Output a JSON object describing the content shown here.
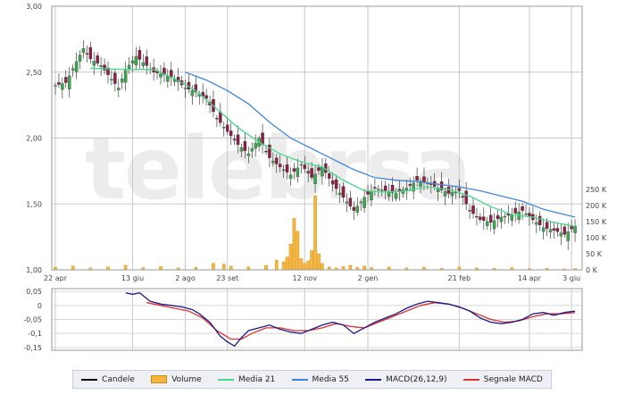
{
  "watermark": "telebrsa",
  "colors": {
    "bull": "#3ea64e",
    "bear": "#8e1f44",
    "volume": "#f5b63c",
    "volume_edge": "#d08a10",
    "ma21": "#45d98a",
    "ma55": "#3f86d8",
    "macd": "#1a1a8c",
    "signal": "#e03030",
    "grid": "#c8c8c8"
  },
  "legend": [
    {
      "label": "Candele",
      "type": "line",
      "color": "#000000"
    },
    {
      "label": "Volume",
      "type": "bar",
      "color": "#f5b63c"
    },
    {
      "label": "Media 21",
      "type": "line",
      "color": "#45d98a"
    },
    {
      "label": "Media 55",
      "type": "line",
      "color": "#3f86d8"
    },
    {
      "label": "MACD(26,12,9)",
      "type": "line",
      "color": "#1a1a8c"
    },
    {
      "label": "Segnale MACD",
      "type": "line",
      "color": "#e03030"
    }
  ],
  "chart_data": [
    {
      "type": "candlestick",
      "title": "",
      "x_tick_labels": [
        "22 apr",
        "13 giu",
        "2 ago",
        "23 set",
        "12 nov",
        "2 gen",
        "21 feb",
        "14 apr",
        "3 giu"
      ],
      "ylim": [
        1.0,
        3.0
      ],
      "y_tick_labels": [
        "3,00",
        "2,50",
        "2,00",
        "1,50",
        "1,00"
      ],
      "volume_ylim": [
        0,
        250000
      ],
      "volume_tick_labels": [
        "250 K",
        "200 K",
        "150 K",
        "100 K",
        "50 K",
        "0 K"
      ],
      "grid": true,
      "close_series": [
        {
          "x": 0,
          "y": 2.4
        },
        {
          "x": 3,
          "y": 2.42
        },
        {
          "x": 6,
          "y": 2.58
        },
        {
          "x": 8,
          "y": 2.68
        },
        {
          "x": 10,
          "y": 2.6
        },
        {
          "x": 13,
          "y": 2.55
        },
        {
          "x": 15,
          "y": 2.48
        },
        {
          "x": 18,
          "y": 2.38
        },
        {
          "x": 20,
          "y": 2.52
        },
        {
          "x": 23,
          "y": 2.62
        },
        {
          "x": 26,
          "y": 2.55
        },
        {
          "x": 28,
          "y": 2.5
        },
        {
          "x": 31,
          "y": 2.48
        },
        {
          "x": 34,
          "y": 2.45
        },
        {
          "x": 37,
          "y": 2.38
        },
        {
          "x": 40,
          "y": 2.35
        },
        {
          "x": 43,
          "y": 2.3
        },
        {
          "x": 46,
          "y": 2.15
        },
        {
          "x": 49,
          "y": 2.05
        },
        {
          "x": 52,
          "y": 1.95
        },
        {
          "x": 55,
          "y": 1.88
        },
        {
          "x": 58,
          "y": 2.0
        },
        {
          "x": 61,
          "y": 1.85
        },
        {
          "x": 64,
          "y": 1.78
        },
        {
          "x": 67,
          "y": 1.72
        },
        {
          "x": 70,
          "y": 1.8
        },
        {
          "x": 73,
          "y": 1.7
        },
        {
          "x": 76,
          "y": 1.78
        },
        {
          "x": 79,
          "y": 1.65
        },
        {
          "x": 82,
          "y": 1.55
        },
        {
          "x": 85,
          "y": 1.45
        },
        {
          "x": 88,
          "y": 1.55
        },
        {
          "x": 91,
          "y": 1.62
        },
        {
          "x": 94,
          "y": 1.6
        },
        {
          "x": 97,
          "y": 1.58
        },
        {
          "x": 100,
          "y": 1.62
        },
        {
          "x": 103,
          "y": 1.68
        },
        {
          "x": 106,
          "y": 1.66
        },
        {
          "x": 109,
          "y": 1.62
        },
        {
          "x": 112,
          "y": 1.58
        },
        {
          "x": 115,
          "y": 1.6
        },
        {
          "x": 118,
          "y": 1.45
        },
        {
          "x": 121,
          "y": 1.38
        },
        {
          "x": 124,
          "y": 1.36
        },
        {
          "x": 127,
          "y": 1.4
        },
        {
          "x": 130,
          "y": 1.42
        },
        {
          "x": 133,
          "y": 1.45
        },
        {
          "x": 136,
          "y": 1.38
        },
        {
          "x": 139,
          "y": 1.32
        },
        {
          "x": 142,
          "y": 1.3
        },
        {
          "x": 145,
          "y": 1.27
        },
        {
          "x": 148,
          "y": 1.33
        }
      ],
      "media21": [
        {
          "x": 10,
          "y": 2.53
        },
        {
          "x": 20,
          "y": 2.52
        },
        {
          "x": 28,
          "y": 2.52
        },
        {
          "x": 34,
          "y": 2.45
        },
        {
          "x": 40,
          "y": 2.36
        },
        {
          "x": 46,
          "y": 2.22
        },
        {
          "x": 52,
          "y": 2.08
        },
        {
          "x": 58,
          "y": 1.97
        },
        {
          "x": 64,
          "y": 1.88
        },
        {
          "x": 70,
          "y": 1.82
        },
        {
          "x": 76,
          "y": 1.78
        },
        {
          "x": 82,
          "y": 1.68
        },
        {
          "x": 88,
          "y": 1.6
        },
        {
          "x": 94,
          "y": 1.59
        },
        {
          "x": 100,
          "y": 1.6
        },
        {
          "x": 106,
          "y": 1.63
        },
        {
          "x": 112,
          "y": 1.61
        },
        {
          "x": 118,
          "y": 1.56
        },
        {
          "x": 124,
          "y": 1.48
        },
        {
          "x": 130,
          "y": 1.42
        },
        {
          "x": 136,
          "y": 1.4
        },
        {
          "x": 142,
          "y": 1.36
        },
        {
          "x": 148,
          "y": 1.33
        }
      ],
      "media55": [
        {
          "x": 37,
          "y": 2.5
        },
        {
          "x": 43,
          "y": 2.44
        },
        {
          "x": 49,
          "y": 2.36
        },
        {
          "x": 55,
          "y": 2.26
        },
        {
          "x": 61,
          "y": 2.12
        },
        {
          "x": 67,
          "y": 2.0
        },
        {
          "x": 73,
          "y": 1.92
        },
        {
          "x": 79,
          "y": 1.84
        },
        {
          "x": 85,
          "y": 1.76
        },
        {
          "x": 91,
          "y": 1.7
        },
        {
          "x": 97,
          "y": 1.68
        },
        {
          "x": 103,
          "y": 1.67
        },
        {
          "x": 109,
          "y": 1.65
        },
        {
          "x": 115,
          "y": 1.63
        },
        {
          "x": 121,
          "y": 1.6
        },
        {
          "x": 127,
          "y": 1.56
        },
        {
          "x": 133,
          "y": 1.52
        },
        {
          "x": 139,
          "y": 1.46
        },
        {
          "x": 145,
          "y": 1.42
        },
        {
          "x": 148,
          "y": 1.4
        }
      ],
      "volume": [
        {
          "x": 0,
          "y": 8000
        },
        {
          "x": 5,
          "y": 12000
        },
        {
          "x": 10,
          "y": 6000
        },
        {
          "x": 15,
          "y": 9000
        },
        {
          "x": 20,
          "y": 14000
        },
        {
          "x": 25,
          "y": 7000
        },
        {
          "x": 30,
          "y": 10000
        },
        {
          "x": 35,
          "y": 6000
        },
        {
          "x": 40,
          "y": 8000
        },
        {
          "x": 45,
          "y": 20000
        },
        {
          "x": 48,
          "y": 18000
        },
        {
          "x": 50,
          "y": 12000
        },
        {
          "x": 55,
          "y": 9000
        },
        {
          "x": 60,
          "y": 14000
        },
        {
          "x": 63,
          "y": 30000
        },
        {
          "x": 65,
          "y": 25000
        },
        {
          "x": 66,
          "y": 40000
        },
        {
          "x": 67,
          "y": 80000
        },
        {
          "x": 68,
          "y": 160000
        },
        {
          "x": 69,
          "y": 120000
        },
        {
          "x": 70,
          "y": 35000
        },
        {
          "x": 71,
          "y": 20000
        },
        {
          "x": 72,
          "y": 28000
        },
        {
          "x": 73,
          "y": 60000
        },
        {
          "x": 74,
          "y": 230000
        },
        {
          "x": 75,
          "y": 50000
        },
        {
          "x": 76,
          "y": 20000
        },
        {
          "x": 78,
          "y": 9000
        },
        {
          "x": 80,
          "y": 6000
        },
        {
          "x": 82,
          "y": 10000
        },
        {
          "x": 84,
          "y": 14000
        },
        {
          "x": 86,
          "y": 8000
        },
        {
          "x": 88,
          "y": 12000
        },
        {
          "x": 90,
          "y": 7000
        },
        {
          "x": 95,
          "y": 9000
        },
        {
          "x": 100,
          "y": 6000
        },
        {
          "x": 105,
          "y": 8000
        },
        {
          "x": 110,
          "y": 5000
        },
        {
          "x": 115,
          "y": 9000
        },
        {
          "x": 120,
          "y": 6000
        },
        {
          "x": 125,
          "y": 5000
        },
        {
          "x": 130,
          "y": 7000
        },
        {
          "x": 135,
          "y": 4000
        },
        {
          "x": 140,
          "y": 5000
        },
        {
          "x": 145,
          "y": 3000
        },
        {
          "x": 148,
          "y": 4000
        }
      ]
    },
    {
      "type": "line",
      "title": "",
      "ylim": [
        -0.16,
        0.06
      ],
      "y_tick_labels": [
        "0,05",
        "0",
        "-0,05",
        "-0,1",
        "-0,15"
      ],
      "grid": true,
      "series": [
        {
          "name": "MACD(26,12,9)",
          "points": [
            {
              "x": 20,
              "y": 0.045
            },
            {
              "x": 22,
              "y": 0.04
            },
            {
              "x": 24,
              "y": 0.045
            },
            {
              "x": 27,
              "y": 0.015
            },
            {
              "x": 30,
              "y": 0.005
            },
            {
              "x": 33,
              "y": 0.0
            },
            {
              "x": 36,
              "y": -0.005
            },
            {
              "x": 39,
              "y": -0.015
            },
            {
              "x": 41,
              "y": -0.03
            },
            {
              "x": 44,
              "y": -0.06
            },
            {
              "x": 47,
              "y": -0.11
            },
            {
              "x": 49,
              "y": -0.13
            },
            {
              "x": 51,
              "y": -0.145
            },
            {
              "x": 53,
              "y": -0.115
            },
            {
              "x": 55,
              "y": -0.09
            },
            {
              "x": 58,
              "y": -0.08
            },
            {
              "x": 61,
              "y": -0.07
            },
            {
              "x": 64,
              "y": -0.085
            },
            {
              "x": 67,
              "y": -0.095
            },
            {
              "x": 70,
              "y": -0.1
            },
            {
              "x": 73,
              "y": -0.085
            },
            {
              "x": 76,
              "y": -0.07
            },
            {
              "x": 79,
              "y": -0.06
            },
            {
              "x": 82,
              "y": -0.07
            },
            {
              "x": 85,
              "y": -0.1
            },
            {
              "x": 88,
              "y": -0.08
            },
            {
              "x": 91,
              "y": -0.06
            },
            {
              "x": 94,
              "y": -0.045
            },
            {
              "x": 97,
              "y": -0.03
            },
            {
              "x": 100,
              "y": -0.01
            },
            {
              "x": 103,
              "y": 0.005
            },
            {
              "x": 106,
              "y": 0.015
            },
            {
              "x": 109,
              "y": 0.01
            },
            {
              "x": 112,
              "y": 0.005
            },
            {
              "x": 115,
              "y": -0.005
            },
            {
              "x": 118,
              "y": -0.02
            },
            {
              "x": 121,
              "y": -0.045
            },
            {
              "x": 124,
              "y": -0.06
            },
            {
              "x": 127,
              "y": -0.065
            },
            {
              "x": 130,
              "y": -0.06
            },
            {
              "x": 133,
              "y": -0.05
            },
            {
              "x": 136,
              "y": -0.03
            },
            {
              "x": 139,
              "y": -0.025
            },
            {
              "x": 142,
              "y": -0.035
            },
            {
              "x": 145,
              "y": -0.025
            },
            {
              "x": 148,
              "y": -0.02
            }
          ]
        },
        {
          "name": "Segnale MACD",
          "points": [
            {
              "x": 26,
              "y": 0.01
            },
            {
              "x": 30,
              "y": 0.0
            },
            {
              "x": 34,
              "y": -0.01
            },
            {
              "x": 38,
              "y": -0.02
            },
            {
              "x": 42,
              "y": -0.045
            },
            {
              "x": 46,
              "y": -0.09
            },
            {
              "x": 50,
              "y": -0.12
            },
            {
              "x": 53,
              "y": -0.12
            },
            {
              "x": 56,
              "y": -0.1
            },
            {
              "x": 60,
              "y": -0.08
            },
            {
              "x": 64,
              "y": -0.08
            },
            {
              "x": 68,
              "y": -0.09
            },
            {
              "x": 72,
              "y": -0.09
            },
            {
              "x": 76,
              "y": -0.08
            },
            {
              "x": 80,
              "y": -0.065
            },
            {
              "x": 84,
              "y": -0.075
            },
            {
              "x": 88,
              "y": -0.08
            },
            {
              "x": 92,
              "y": -0.06
            },
            {
              "x": 96,
              "y": -0.04
            },
            {
              "x": 100,
              "y": -0.02
            },
            {
              "x": 104,
              "y": 0.0
            },
            {
              "x": 108,
              "y": 0.01
            },
            {
              "x": 112,
              "y": 0.005
            },
            {
              "x": 116,
              "y": -0.01
            },
            {
              "x": 120,
              "y": -0.03
            },
            {
              "x": 124,
              "y": -0.05
            },
            {
              "x": 128,
              "y": -0.06
            },
            {
              "x": 132,
              "y": -0.055
            },
            {
              "x": 136,
              "y": -0.04
            },
            {
              "x": 140,
              "y": -0.03
            },
            {
              "x": 144,
              "y": -0.03
            },
            {
              "x": 148,
              "y": -0.025
            }
          ]
        }
      ]
    }
  ]
}
